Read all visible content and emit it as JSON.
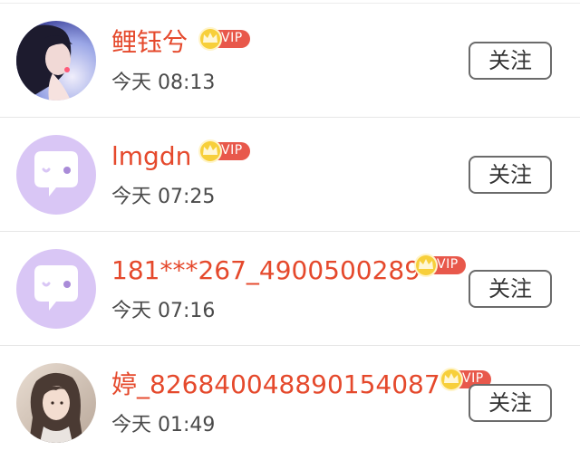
{
  "users": [
    {
      "name": "鲤钰兮",
      "vip": "VIP",
      "time": "今天 08:13",
      "follow": "关注",
      "avatar": "portrait-photo"
    },
    {
      "name": "lmgdn",
      "vip": "VIP",
      "time": "今天 07:25",
      "follow": "关注",
      "avatar": "default-chat-bubble"
    },
    {
      "name": "181***267_4900500289",
      "vip": "VIP",
      "time": "今天 07:16",
      "follow": "关注",
      "avatar": "default-chat-bubble"
    },
    {
      "name": "婷_826840048890154087",
      "vip": "VIP",
      "time": "今天 01:49",
      "follow": "关注",
      "avatar": "portrait-photo"
    }
  ],
  "colors": {
    "name": "#e5492c",
    "vip_badge": "#e8584b",
    "crown": "#f5c22b",
    "default_avatar": "#d9c6f5"
  }
}
